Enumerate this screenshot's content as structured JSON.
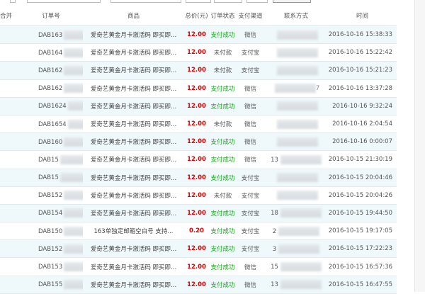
{
  "headers": {
    "merge": "合并",
    "order_no": "订单号",
    "product": "商品",
    "total": "总价(元)",
    "status": "订单状态",
    "channel": "支付渠道",
    "contact": "联系方式",
    "time": "时间"
  },
  "rows": [
    {
      "order": "DAB163",
      "order_tail": "02",
      "product": "爱奇艺黄金月卡激活码 即买即...",
      "amount": "12.00",
      "status": "支付成功",
      "status_ok": true,
      "channel": "微信",
      "contact": "",
      "contact_tail": "",
      "time": "2016-10-16 15:38:33"
    },
    {
      "order": "DAB164",
      "order_tail": "?",
      "product": "爱奇艺黄金月卡激活码 即买即...",
      "amount": "12.00",
      "status": "未付款",
      "status_ok": false,
      "channel": "支付宝",
      "contact": "",
      "contact_tail": "",
      "time": "2016-10-16 15:22:42"
    },
    {
      "order": "DAB162",
      "order_tail": "4",
      "product": "爱奇艺黄金月卡激活码 即买即...",
      "amount": "12.00",
      "status": "未付款",
      "status_ok": false,
      "channel": "支付宝",
      "contact": "",
      "contact_tail": "",
      "time": "2016-10-16 15:21:23"
    },
    {
      "order": "DAB162",
      "order_tail": "3",
      "product": "爱奇艺黄金月卡激活码 即买即...",
      "amount": "12.00",
      "status": "支付成功",
      "status_ok": true,
      "channel": "微信",
      "contact": "",
      "contact_tail": "7",
      "time": "2016-10-16 13:37:28"
    },
    {
      "order": "DAB1624",
      "order_tail": "",
      "product": "爱奇艺黄金月卡激活码 即买即...",
      "amount": "12.00",
      "status": "支付成功",
      "status_ok": true,
      "channel": "微信",
      "contact": "",
      "contact_tail": "",
      "time": "2016-10-16 9:32:24"
    },
    {
      "order": "DAB1654",
      "order_tail": "",
      "product": "爱奇艺黄金月卡激活码 即买即...",
      "amount": "12.00",
      "status": "未付款",
      "status_ok": false,
      "channel": "微信",
      "contact": "",
      "contact_tail": "",
      "time": "2016-10-16 2:04:54"
    },
    {
      "order": "DAB160",
      "order_tail": "01",
      "product": "爱奇艺黄金月卡激活码 即买即...",
      "amount": "12.00",
      "status": "支付成功",
      "status_ok": true,
      "channel": "微信",
      "contact": "",
      "contact_tail": "",
      "time": "2016-10-16 0:00:07"
    },
    {
      "order": "DAB15",
      "order_tail": "9",
      "product": "爱奇艺黄金月卡激活码 即买即...",
      "amount": "12.00",
      "status": "支付成功",
      "status_ok": true,
      "channel": "微信",
      "contact": "13",
      "contact_tail": "",
      "time": "2016-10-15 21:30:19"
    },
    {
      "order": "DAB15",
      "order_tail": "",
      "product": "爱奇艺黄金月卡激活码 即买即...",
      "amount": "12.00",
      "status": "支付成功",
      "status_ok": true,
      "channel": "支付宝",
      "contact": "",
      "contact_tail": "",
      "time": "2016-10-15 20:04:46"
    },
    {
      "order": "DAB152",
      "order_tail": "",
      "product": "爱奇艺黄金月卡激活码 即买即...",
      "amount": "12.00",
      "status": "未付款",
      "status_ok": false,
      "channel": "支付宝",
      "contact": "",
      "contact_tail": "",
      "time": "2016-10-15 20:04:26"
    },
    {
      "order": "DAB154",
      "order_tail": "",
      "product": "爱奇艺黄金月卡激活码 即买即...",
      "amount": "12.00",
      "status": "支付成功",
      "status_ok": true,
      "channel": "支付宝",
      "contact": "18",
      "contact_tail": "",
      "time": "2016-10-15 19:44:50"
    },
    {
      "order": "DAB150",
      "order_tail": "",
      "product": "163单独定邮箱空白号 支持...",
      "amount": "0.20",
      "status": "支付成功",
      "status_ok": true,
      "channel": "支付宝",
      "contact": "2",
      "contact_tail": "",
      "time": "2016-10-15 19:17:05"
    },
    {
      "order": "DAB152",
      "order_tail": "",
      "product": "爱奇艺黄金月卡激活码 即买即...",
      "amount": "12.00",
      "status": "支付成功",
      "status_ok": true,
      "channel": "支付宝",
      "contact": "3",
      "contact_tail": "",
      "time": "2016-10-15 17:22:23"
    },
    {
      "order": "DAB153",
      "order_tail": "",
      "product": "爱奇艺黄金月卡激活码 即买即...",
      "amount": "12.00",
      "status": "支付成功",
      "status_ok": true,
      "channel": "微信",
      "contact": "15",
      "contact_tail": "",
      "time": "2016-10-15 16:57:36"
    },
    {
      "order": "DAB155",
      "order_tail": "",
      "product": "爱奇艺黄金月卡激活码 即买即...",
      "amount": "12.00",
      "status": "支付成功",
      "status_ok": true,
      "channel": "微信",
      "contact": "13",
      "contact_tail": "",
      "time": "2016-10-15 16:47:55"
    }
  ],
  "colors": {
    "amount": "#e00000",
    "status_success": "#16a51b",
    "row_stripe": "#eff8fb"
  }
}
